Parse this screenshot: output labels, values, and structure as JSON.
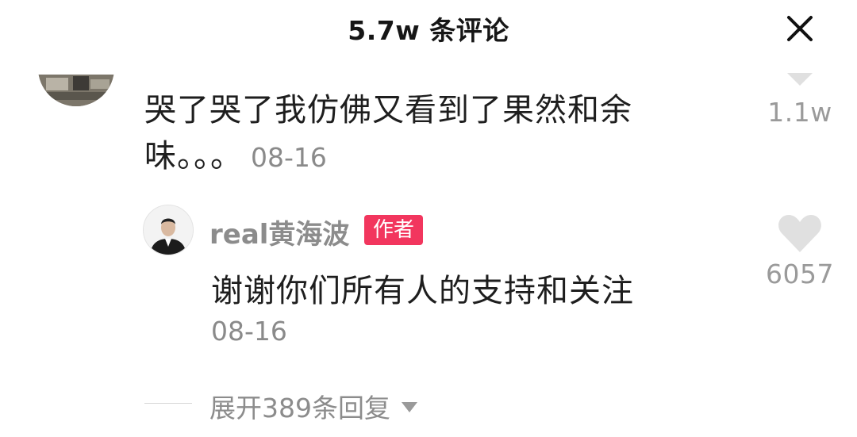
{
  "header": {
    "title": "5.7w 条评论"
  },
  "comments": [
    {
      "text": "哭了哭了我仿佛又看到了果然和余味。。。",
      "date": "08-16",
      "like_count": "1.1w",
      "reply": {
        "username": "real黄海波",
        "badge": "作者",
        "text": "谢谢你们所有人的支持和关注",
        "date": "08-16",
        "like_count": "6057"
      },
      "expand_label": "展开389条回复"
    }
  ],
  "colors": {
    "badge_bg": "#f2365e",
    "secondary_text": "#8c8c8c",
    "heart": "#e0e0e0"
  },
  "icons": {
    "close": "close-icon",
    "like": "heart-icon",
    "expand": "caret-down-icon"
  }
}
